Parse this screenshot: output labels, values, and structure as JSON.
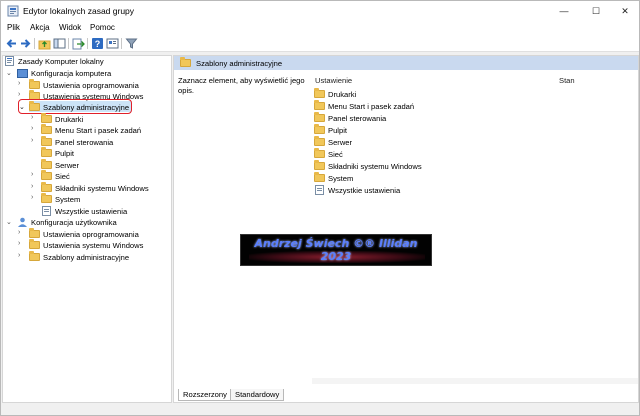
{
  "window": {
    "title": "Edytor lokalnych zasad grupy",
    "controls": {
      "minimize": "—",
      "maximize": "☐",
      "close": "✕"
    }
  },
  "menu": [
    "Plik",
    "Akcja",
    "Widok",
    "Pomoc"
  ],
  "toolbar": {
    "icons": [
      "back-arrow-icon",
      "forward-arrow-icon",
      "folder-up-icon",
      "show-hide-tree-icon",
      "export-icon",
      "help-icon",
      "properties-icon",
      "filter-icon"
    ]
  },
  "tree": {
    "root": "Zasady Komputer lokalny",
    "computer_config": "Konfiguracja komputera",
    "computer_children": {
      "software": "Ustawienia oprogramowania",
      "windows": "Ustawienia systemu Windows",
      "admin": "Szablony administracyjne"
    },
    "admin_children": [
      "Drukarki",
      "Menu Start i pasek zadań",
      "Panel sterowania",
      "Pulpit",
      "Serwer",
      "Sieć",
      "Składniki systemu Windows",
      "System",
      "Wszystkie ustawienia"
    ],
    "user_config": "Konfiguracja użytkownika",
    "user_children": {
      "software": "Ustawienia oprogramowania",
      "windows": "Ustawienia systemu Windows",
      "admin": "Szablony administracyjne"
    }
  },
  "details": {
    "header": "Szablony administracyjne",
    "description": "Zaznacz element, aby wyświetlić jego opis.",
    "columns": {
      "setting": "Ustawienie",
      "state": "Stan"
    },
    "items": [
      "Drukarki",
      "Menu Start i pasek zadań",
      "Panel sterowania",
      "Pulpit",
      "Serwer",
      "Sieć",
      "Składniki systemu Windows",
      "System",
      "Wszystkie ustawienia"
    ]
  },
  "banner": {
    "text": "Andrzej Świech ©® Illidan 2023"
  },
  "tabs": {
    "extended": "Rozszerzony",
    "standard": "Standardowy"
  },
  "colors": {
    "selection": "#cce4f7",
    "highlight_border": "#e0202a",
    "header_strip": "#c9d9ef",
    "folder": "#f1c75a",
    "banner_text": "#5a7fff"
  }
}
